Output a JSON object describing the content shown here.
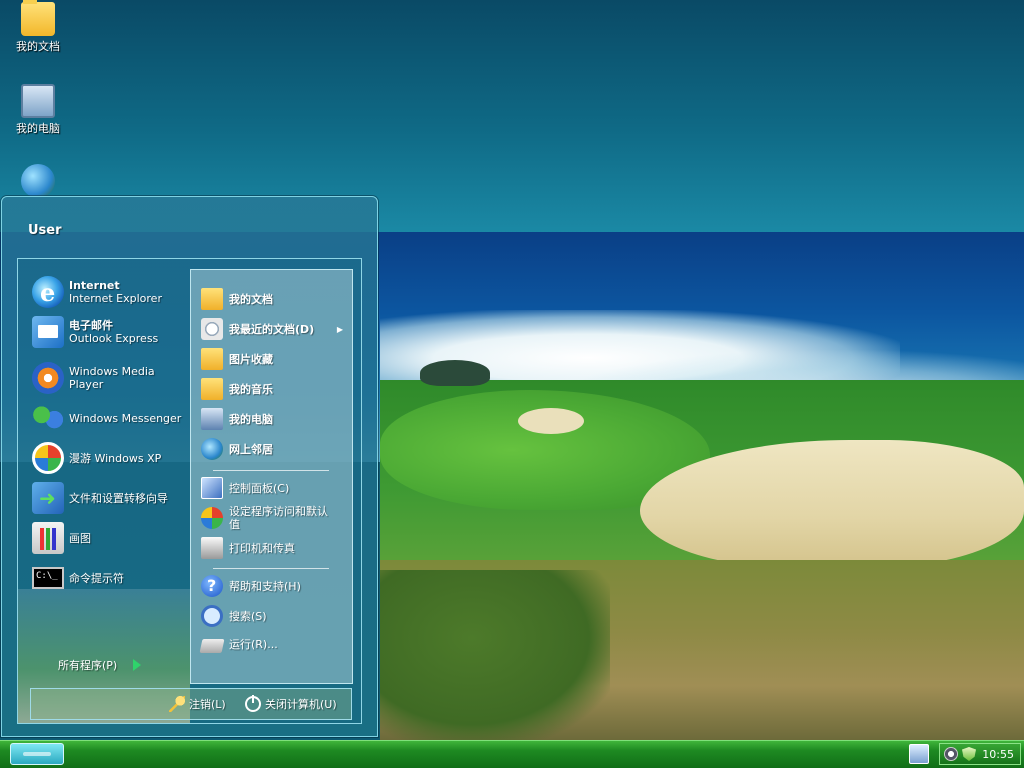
{
  "desktop": {
    "icons": [
      {
        "label": "我的文档",
        "icon": "folder-documents-icon"
      },
      {
        "label": "我的电脑",
        "icon": "computer-icon"
      },
      {
        "label": "",
        "icon": "network-globe-icon"
      }
    ]
  },
  "start_menu": {
    "user_name": "User",
    "pinned": [
      {
        "title": "Internet",
        "subtitle": "Internet Explorer",
        "icon": "ie-icon"
      },
      {
        "title": "电子邮件",
        "subtitle": "Outlook Express",
        "icon": "mail-icon"
      }
    ],
    "recent": [
      {
        "label": "Windows Media Player",
        "icon": "media-player-icon"
      },
      {
        "label": "Windows Messenger",
        "icon": "messenger-icon"
      },
      {
        "label": "漫游 Windows XP",
        "icon": "tour-icon"
      },
      {
        "label": "文件和设置转移向导",
        "icon": "migration-wizard-icon"
      },
      {
        "label": "画图",
        "icon": "paint-icon"
      },
      {
        "label": "命令提示符",
        "icon": "command-prompt-icon"
      }
    ],
    "all_programs_label": "所有程序(P)",
    "right_items": [
      {
        "label": "我的文档",
        "icon": "my-documents-icon"
      },
      {
        "label": "我最近的文档(D)",
        "icon": "recent-documents-icon",
        "submenu": "▶"
      },
      {
        "label": "图片收藏",
        "icon": "my-pictures-icon"
      },
      {
        "label": "我的音乐",
        "icon": "my-music-icon"
      },
      {
        "label": "我的电脑",
        "icon": "my-computer-icon"
      },
      {
        "label": "网上邻居",
        "icon": "network-places-icon"
      },
      {
        "label": "控制面板(C)",
        "icon": "control-panel-icon"
      },
      {
        "label": "设定程序访问和默认值",
        "icon": "program-defaults-icon"
      },
      {
        "label": "打印机和传真",
        "icon": "printer-icon"
      },
      {
        "label": "帮助和支持(H)",
        "icon": "help-icon"
      },
      {
        "label": "搜索(S)",
        "icon": "search-icon"
      },
      {
        "label": "运行(R)...",
        "icon": "run-icon"
      }
    ],
    "footer": {
      "logoff_label": "注销(L)",
      "shutdown_label": "关闭计算机(U)"
    }
  },
  "taskbar": {
    "clock": "10:55"
  }
}
